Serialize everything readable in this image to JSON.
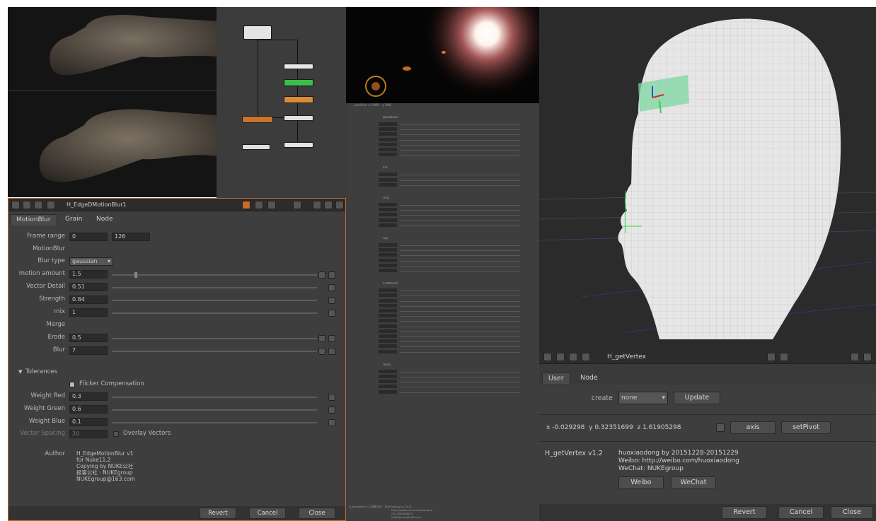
{
  "motionblur_panel": {
    "title": "H_EdgeDMotionBlur1",
    "tabs": [
      "MotionBlur",
      "Grain",
      "Node"
    ],
    "frame_range": {
      "label": "Frame range",
      "start": "0",
      "end": "126"
    },
    "section_motionblur": "MotionBlur",
    "blur_type": {
      "label": "Blur type",
      "value": "gaussian"
    },
    "motion_amount": {
      "label": "motion amount",
      "value": "1.5"
    },
    "vector_detail": {
      "label": "Vector Detail",
      "value": "0.51"
    },
    "strength": {
      "label": "Strength",
      "value": "0.84"
    },
    "mix": {
      "label": "mix",
      "value": "1"
    },
    "section_merge": "Merge",
    "erode": {
      "label": "Erode",
      "value": "0.5"
    },
    "blur": {
      "label": "Blur",
      "value": "7"
    },
    "tolerances": "Tolerances",
    "flicker_compensation": "Flicker Compensation",
    "weight_red": {
      "label": "Weight Red",
      "value": "0.3"
    },
    "weight_green": {
      "label": "Weight Green",
      "value": "0.6"
    },
    "weight_blue": {
      "label": "Weight Blue",
      "value": "0.1"
    },
    "vector_spacing": {
      "label": "Vector Spacing",
      "value": "20"
    },
    "overlay_vectors": "Overlay Vectors",
    "author_label": "Author",
    "author_lines": [
      "H_EdgeMotionBlur v1 for Nuke11.2",
      "Copying by NUKE公社",
      "极客公社 · NUKEgroup",
      "NUKEgroup@163.com"
    ],
    "buttons": {
      "revert": "Revert",
      "cancel": "Cancel",
      "close": "Close"
    }
  },
  "getvertex_panel": {
    "title": "H_getVertex",
    "tabs": [
      "User",
      "Node"
    ],
    "create_label": "create",
    "create_value": "none",
    "update_button": "Update",
    "coords": {
      "x_label": "x",
      "x": "-0.029298",
      "y_label": "y",
      "y": "0.32351699",
      "z_label": "z",
      "z": "1.61905298"
    },
    "axis_button": "axis",
    "setpivot_button": "setPivot",
    "info_title": "H_getVertex v1.2",
    "info_lines": [
      "huoxiaodong by 20151228-20151229",
      "Weibo: http://weibo.com/huoxiaodong",
      "WeChat: NUKEgroup"
    ],
    "weibo_button": "Weibo",
    "wechat_button": "WeChat",
    "buttons": {
      "revert": "Revert",
      "cancel": "Cancel",
      "close": "Close"
    }
  },
  "flare_panel": {
    "top_field_left": "position x 1000",
    "top_field_right": "y 586",
    "sections": [
      "glowbase",
      "iris",
      "ring",
      "ray",
      "scattered",
      "main"
    ],
    "footer_lines": [
      "H_lensflare v1.0 极客公社 · NUKEgroup by 2015",
      "http://weibo.com/huoxiaodong",
      "QQ: 654064053",
      "NUKEgroup@163.com"
    ]
  },
  "colors": {
    "panel_bg": "#3e3e3e",
    "field_bg": "#2b2b2b",
    "accent_orange": "#c86a28",
    "node_green": "#3bbf4a",
    "node_orange": "#d98a3a",
    "node_white": "#e8e8e8"
  },
  "icons": [
    "eye-icon",
    "node-icon",
    "help-icon",
    "close-icon",
    "gear-icon"
  ]
}
